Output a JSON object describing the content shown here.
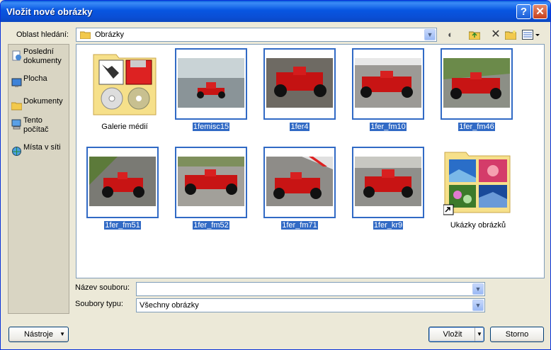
{
  "window": {
    "title": "Vložit nové obrázky"
  },
  "lookin": {
    "label": "Oblast hledání:",
    "value": "Obrázky"
  },
  "places": [
    {
      "label": "Poslední dokumenty"
    },
    {
      "label": "Plocha"
    },
    {
      "label": "Dokumenty"
    },
    {
      "label": "Tento počítač"
    },
    {
      "label": "Místa v síti"
    }
  ],
  "files": [
    {
      "name": "Galerie médií",
      "selected": false
    },
    {
      "name": "1femisc15",
      "selected": true
    },
    {
      "name": "1fer4",
      "selected": true
    },
    {
      "name": "1fer_fm10",
      "selected": true
    },
    {
      "name": "1fer_fm46",
      "selected": true
    },
    {
      "name": "1fer_fm51",
      "selected": true
    },
    {
      "name": "1fer_fm52",
      "selected": true
    },
    {
      "name": "1fer_fm71",
      "selected": true
    },
    {
      "name": "1fer_kr9",
      "selected": true
    },
    {
      "name": "Ukázky obrázků",
      "selected": false
    }
  ],
  "filename": {
    "label": "Název souboru:",
    "value": ""
  },
  "filetype": {
    "label": "Soubory typu:",
    "value": "Všechny obrázky"
  },
  "buttons": {
    "tools": "Nástroje",
    "insert": "Vložit",
    "cancel": "Storno"
  }
}
